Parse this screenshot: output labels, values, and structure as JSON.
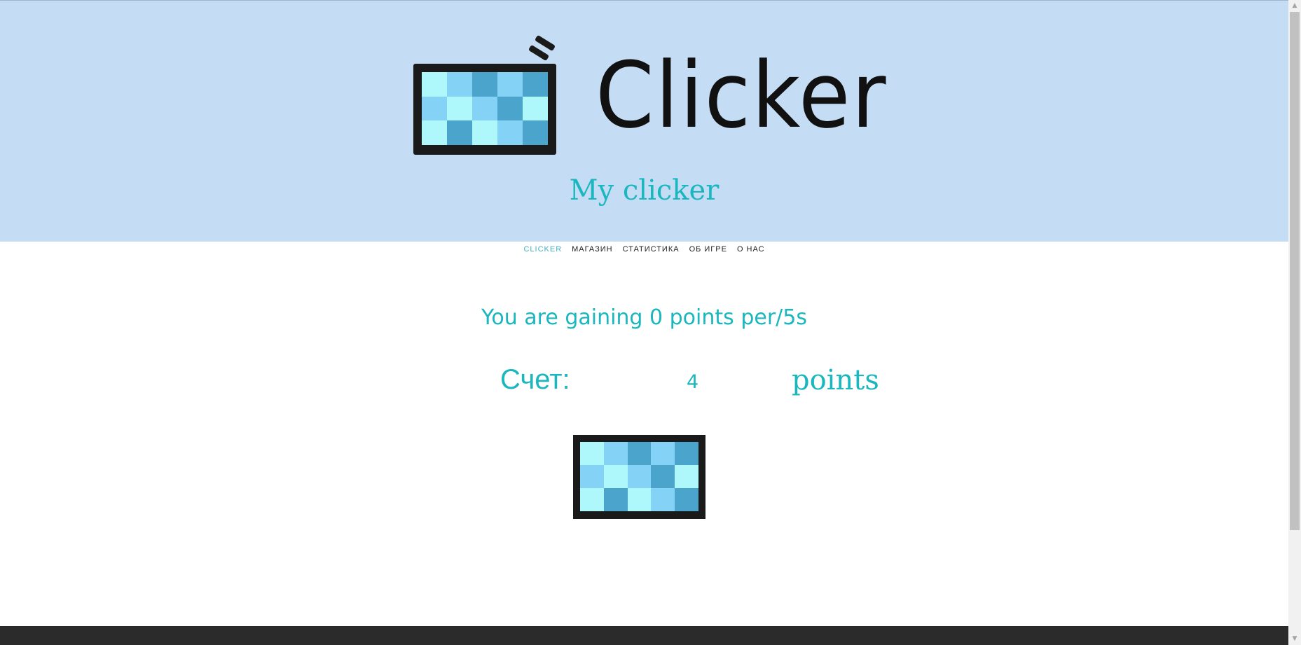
{
  "header": {
    "brand_title": "Clicker",
    "subtitle": "My clicker"
  },
  "nav": {
    "items": [
      {
        "label": "CLICKER",
        "active": true
      },
      {
        "label": "МАГАЗИН",
        "active": false
      },
      {
        "label": "СТАТИСТИКА",
        "active": false
      },
      {
        "label": "ОБ ИГРЕ",
        "active": false
      },
      {
        "label": "О НАС",
        "active": false
      }
    ]
  },
  "game": {
    "rate_text": "You are gaining 0 points per/5s",
    "score_label": "Счет:",
    "score_value": "4",
    "score_unit": "points"
  },
  "colors": {
    "header_bg": "#c5dcf5",
    "accent": "#1ab7bf",
    "nav_active": "#46b0c2",
    "footer_bg": "#2b2b2b",
    "tile_light": "#aef8fb",
    "tile_mid": "#84d2f5",
    "tile_dark": "#4ba4cb"
  },
  "icons": {
    "logo": "monitor-logo-icon",
    "clicker": "monitor-clicker-icon"
  }
}
